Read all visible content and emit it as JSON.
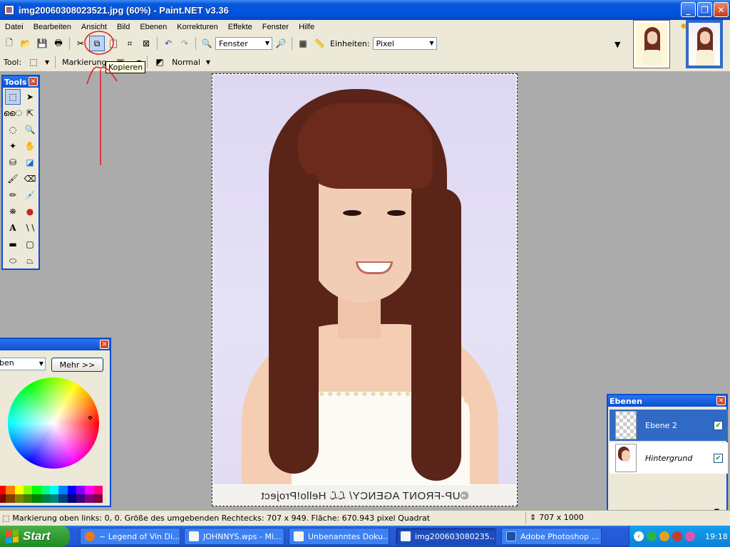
{
  "window": {
    "title": "img20060308023521.jpg (60%) - Paint.NET v3.36",
    "buttons": [
      "_",
      "❐",
      "✕"
    ]
  },
  "menu": [
    "Datei",
    "Bearbeiten",
    "Ansicht",
    "Bild",
    "Ebenen",
    "Korrekturen",
    "Effekte",
    "Fenster",
    "Hilfe"
  ],
  "toolbar1": {
    "zoom_value": "Fenster",
    "units_label": "Einheiten:",
    "units_value": "Pixel"
  },
  "toolbar2": {
    "tool_label": "Tool:",
    "selection_mode_label": "Markierungsmodus",
    "blend_mode": "Normal"
  },
  "tooltip": "Kopieren",
  "canvas": {
    "watermark": "©UP-FRONT AGENCY/ ℒℒ Hello!Project"
  },
  "tools_window": {
    "title": "Tools",
    "close": "✕"
  },
  "colors_window": {
    "dropdown_value": "ben",
    "more_button": "Mehr >>",
    "palette": [
      "#ff0000",
      "#ff8000",
      "#ffff00",
      "#80ff00",
      "#00ff00",
      "#00ff80",
      "#00ffff",
      "#0080ff",
      "#0000ff",
      "#8000ff",
      "#ff00ff",
      "#ff0080",
      "#800000",
      "#804000",
      "#808000",
      "#408000",
      "#008000",
      "#008040",
      "#008080",
      "#004080",
      "#000080",
      "#400080",
      "#800080",
      "#800040"
    ]
  },
  "layers_window": {
    "title": "Ebenen",
    "layers": [
      {
        "name": "Ebene 2",
        "visible": true
      },
      {
        "name": "Hintergrund",
        "visible": true
      }
    ]
  },
  "status": {
    "text": "Markierung oben links: 0, 0. Größe des umgebenden Rechtecks: 707 x 949. Fläche: 670.943 pixel Quadrat",
    "image_size": "707 x 1000"
  },
  "taskbar": {
    "start": "Start",
    "tasks": [
      {
        "label": "~ Legend of Vin Di...",
        "color": "#e8781e"
      },
      {
        "label": "JOHNNYS.wps - Mi...",
        "color": "#f5f5f5"
      },
      {
        "label": "Unbenanntes Doku...",
        "color": "#f5f5f5"
      },
      {
        "label": "img200603080235...",
        "color": "#f5f5f5"
      },
      {
        "label": "Adobe Photoshop ...",
        "color": "#1f4f9e"
      }
    ],
    "clock": "19:18"
  },
  "colors": {
    "accent": "#0a4fd1",
    "chrome": "#ece9d8",
    "annotation": "#e0202a"
  }
}
